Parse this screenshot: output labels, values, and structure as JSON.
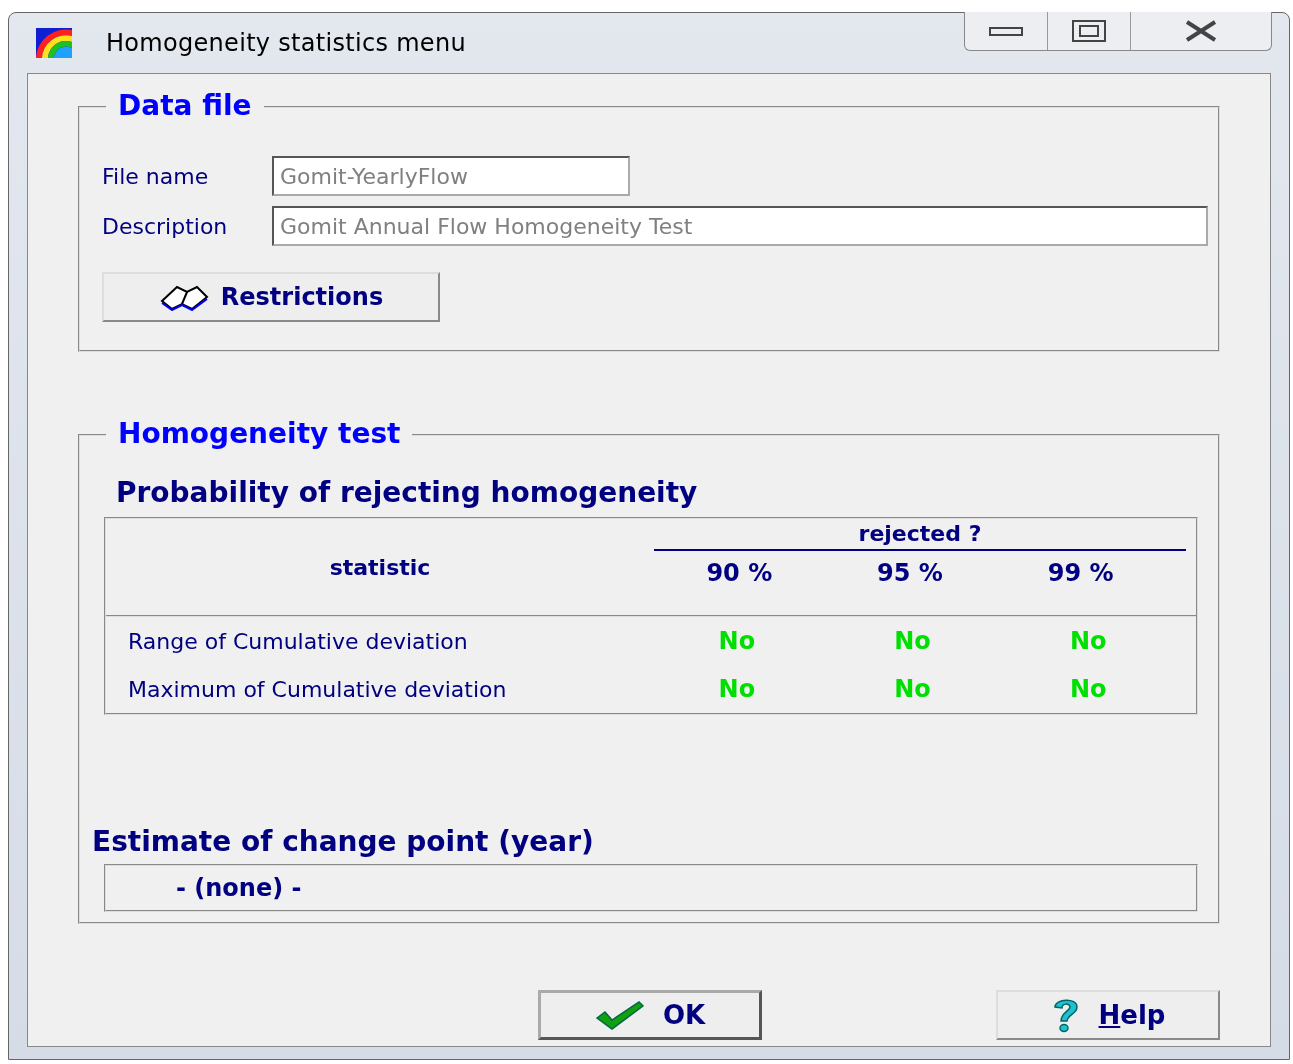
{
  "window": {
    "title": "Homogeneity statistics menu"
  },
  "data_file": {
    "legend": "Data file",
    "fields": [
      {
        "label": "File name",
        "value": "Gomit-YearlyFlow",
        "wide": false,
        "disabled": true
      },
      {
        "label": "Description",
        "value": "Gomit Annual Flow Homogeneity Test",
        "wide": true,
        "disabled": true
      }
    ],
    "restrictions_button": "Restrictions"
  },
  "homogeneity_test": {
    "legend": "Homogeneity test",
    "heading": "Probability of rejecting homogeneity",
    "table": {
      "statistic_header": "statistic",
      "group_header": "rejected ?",
      "levels": [
        "90 %",
        "95 %",
        "99 %"
      ],
      "rows": [
        {
          "statistic": "Range of Cumulative deviation",
          "results": [
            {
              "text": "No",
              "rejected": false
            },
            {
              "text": "No",
              "rejected": false
            },
            {
              "text": "No",
              "rejected": false
            }
          ]
        },
        {
          "statistic": "Maximum of Cumulative deviation",
          "results": [
            {
              "text": "No",
              "rejected": false
            },
            {
              "text": "No",
              "rejected": false
            },
            {
              "text": "No",
              "rejected": false
            }
          ]
        }
      ]
    },
    "change_point": {
      "heading": "Estimate of change point (year)",
      "value": "- (none) -"
    }
  },
  "buttons": [
    {
      "kind": "ok",
      "label": "OK"
    },
    {
      "kind": "help",
      "label": "Help",
      "mnemonic_first": true
    }
  ]
}
